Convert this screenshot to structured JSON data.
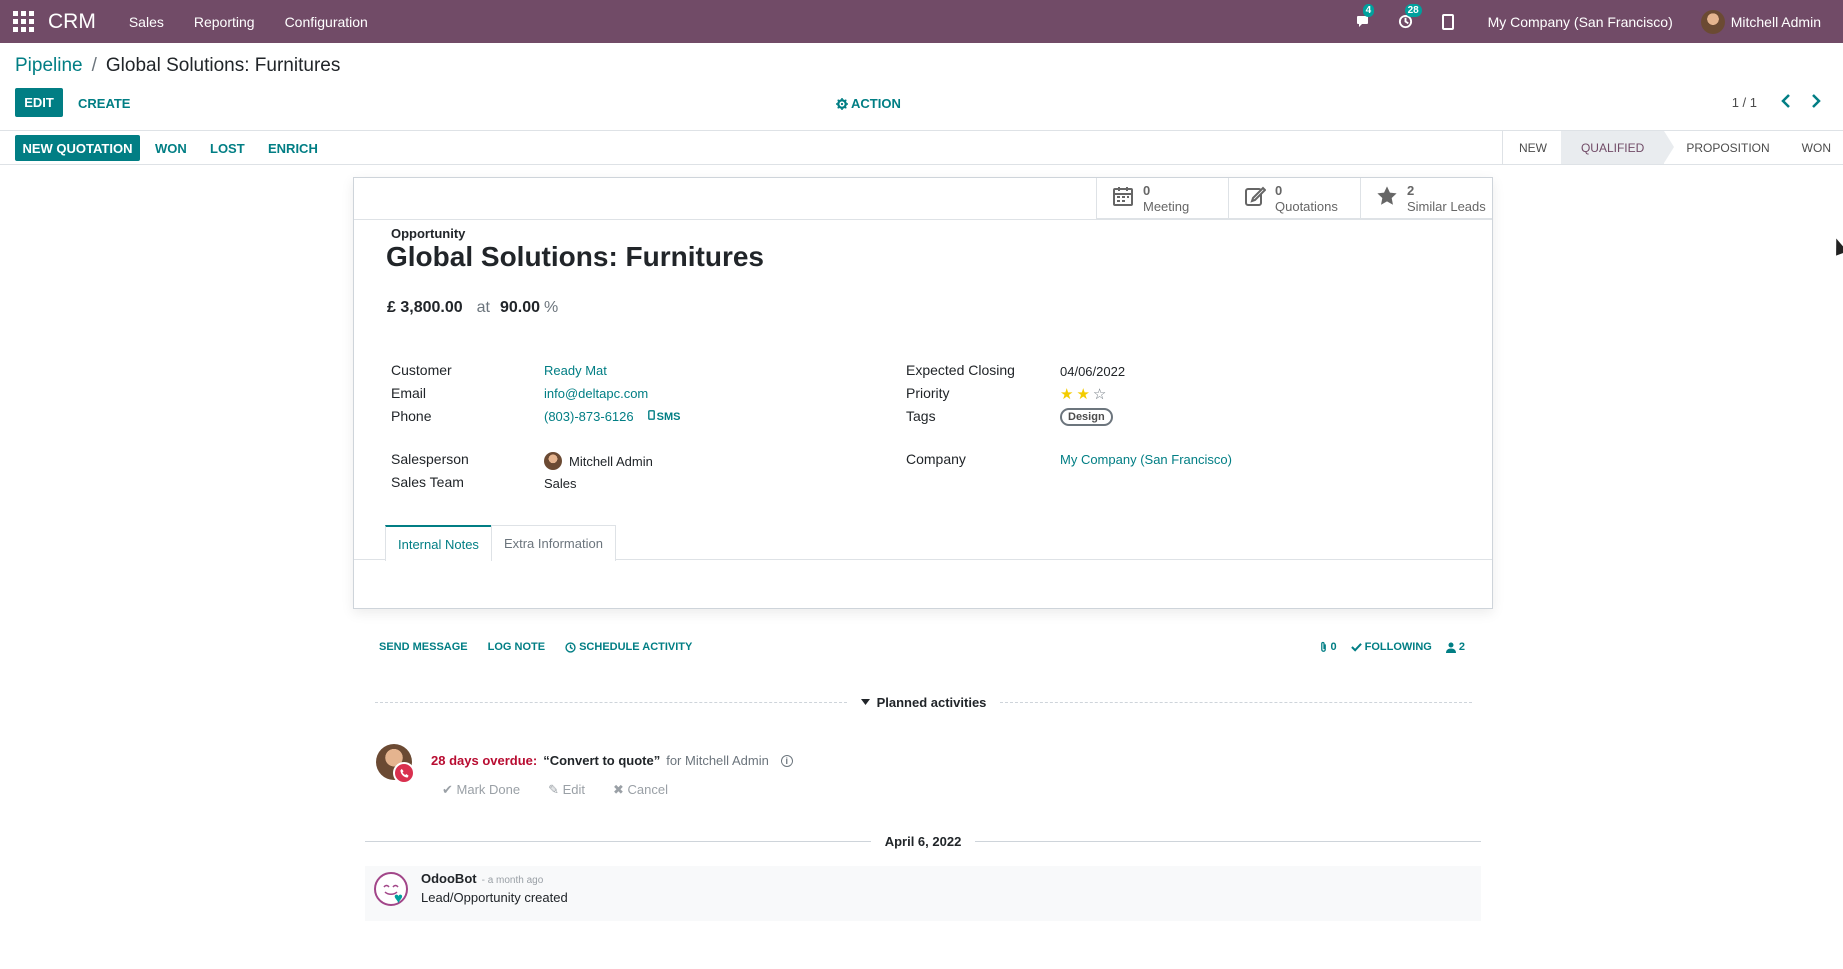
{
  "navbar": {
    "app_name": "CRM",
    "menus": [
      "Sales",
      "Reporting",
      "Configuration"
    ],
    "messages_count": "4",
    "activities_count": "28",
    "company": "My Company (San Francisco)",
    "user": "Mitchell Admin"
  },
  "breadcrumb": {
    "parent": "Pipeline",
    "separator": "/",
    "current": "Global Solutions: Furnitures"
  },
  "control": {
    "edit": "EDIT",
    "create": "CREATE",
    "action": "ACTION",
    "pager": "1 / 1"
  },
  "statusbar": {
    "buttons": [
      "NEW QUOTATION",
      "WON",
      "LOST",
      "ENRICH"
    ],
    "stages": [
      "NEW",
      "QUALIFIED",
      "PROPOSITION",
      "WON"
    ],
    "active_stage": "QUALIFIED"
  },
  "smart_buttons": [
    {
      "count": "0",
      "label": "Meeting",
      "icon": "calendar-icon"
    },
    {
      "count": "0",
      "label": "Quotations",
      "icon": "pencil-square-icon"
    },
    {
      "count": "2",
      "label": "Similar Leads",
      "icon": "star-icon"
    }
  ],
  "form": {
    "type_label": "Opportunity",
    "title": "Global Solutions: Furnitures",
    "expected_revenue": "£ 3,800.00",
    "at": "at",
    "probability": "90.00",
    "percent": "%",
    "customer_label": "Customer",
    "customer": "Ready Mat",
    "email_label": "Email",
    "email": "info@deltapc.com",
    "phone_label": "Phone",
    "phone": "(803)-873-6126",
    "sms": "SMS",
    "salesperson_label": "Salesperson",
    "salesperson": "Mitchell Admin",
    "team_label": "Sales Team",
    "team": "Sales",
    "closing_label": "Expected Closing",
    "closing": "04/06/2022",
    "priority_label": "Priority",
    "priority_stars": 2,
    "priority_max": 3,
    "tags_label": "Tags",
    "tag": "Design",
    "company_label": "Company",
    "company": "My Company (San Francisco)"
  },
  "tabs": [
    "Internal Notes",
    "Extra Information"
  ],
  "chatter": {
    "send_message": "SEND MESSAGE",
    "log_note": "LOG NOTE",
    "schedule_activity": "SCHEDULE ACTIVITY",
    "attachments": "0",
    "following": "FOLLOWING",
    "followers": "2",
    "planned_label": "Planned activities",
    "activity": {
      "overdue": "28 days overdue:",
      "summary": "“Convert to quote”",
      "assignee": "for Mitchell Admin",
      "mark_done": "Mark Done",
      "edit": "Edit",
      "cancel": "Cancel"
    },
    "date_separator": "April 6, 2022",
    "message": {
      "author": "OdooBot",
      "date": "- a month ago",
      "body": "Lead/Opportunity created"
    }
  },
  "colors": {
    "navbar": "#714B67",
    "primary": "#017e84",
    "overdue": "#b80c31",
    "star": "#f3cc00"
  }
}
